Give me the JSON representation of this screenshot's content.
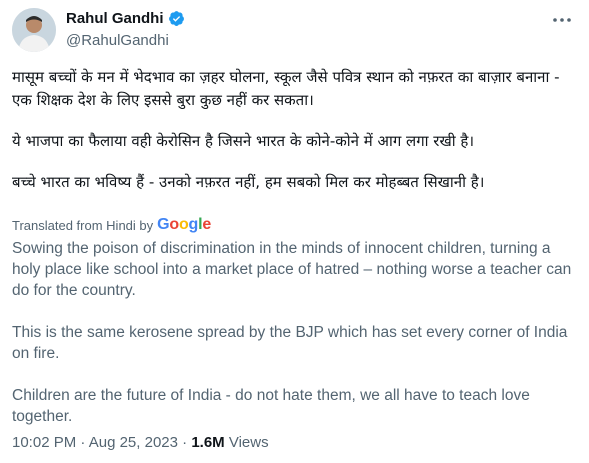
{
  "author": {
    "name": "Rahul Gandhi",
    "handle": "@RahulGandhi",
    "verified_color": "#1d9bf0"
  },
  "tweet": {
    "hindi_paragraphs": [
      "मासूम बच्चों के मन में भेदभाव का ज़हर घोलना, स्कूल जैसे पवित्र स्थान को नफ़रत का बाज़ार बनाना - एक शिक्षक देश के लिए इससे बुरा कुछ नहीं कर सकता।",
      "ये भाजपा का फैलाया वही केरोसिन है जिसने भारत के कोने-कोने में आग लगा रखी है।",
      "बच्चे भारत का भविष्य हैं - उनको नफ़रत नहीं, हम सबको मिल कर मोहब्बत सिखानी है।"
    ],
    "translated_label": "Translated from Hindi by",
    "translator": "Google",
    "english_paragraphs": [
      "Sowing the poison of discrimination in the minds of innocent children, turning a holy place like school into a market place of hatred – nothing worse a teacher can do for the country.",
      "This is the same kerosene spread by the BJP which has set every corner of India on fire.",
      "Children are the future of India - do not hate them, we all have to teach love together."
    ]
  },
  "meta": {
    "time": "10:02 PM",
    "separator": "·",
    "date": "Aug 25, 2023",
    "views_count": "1.6M",
    "views_label": "Views"
  }
}
